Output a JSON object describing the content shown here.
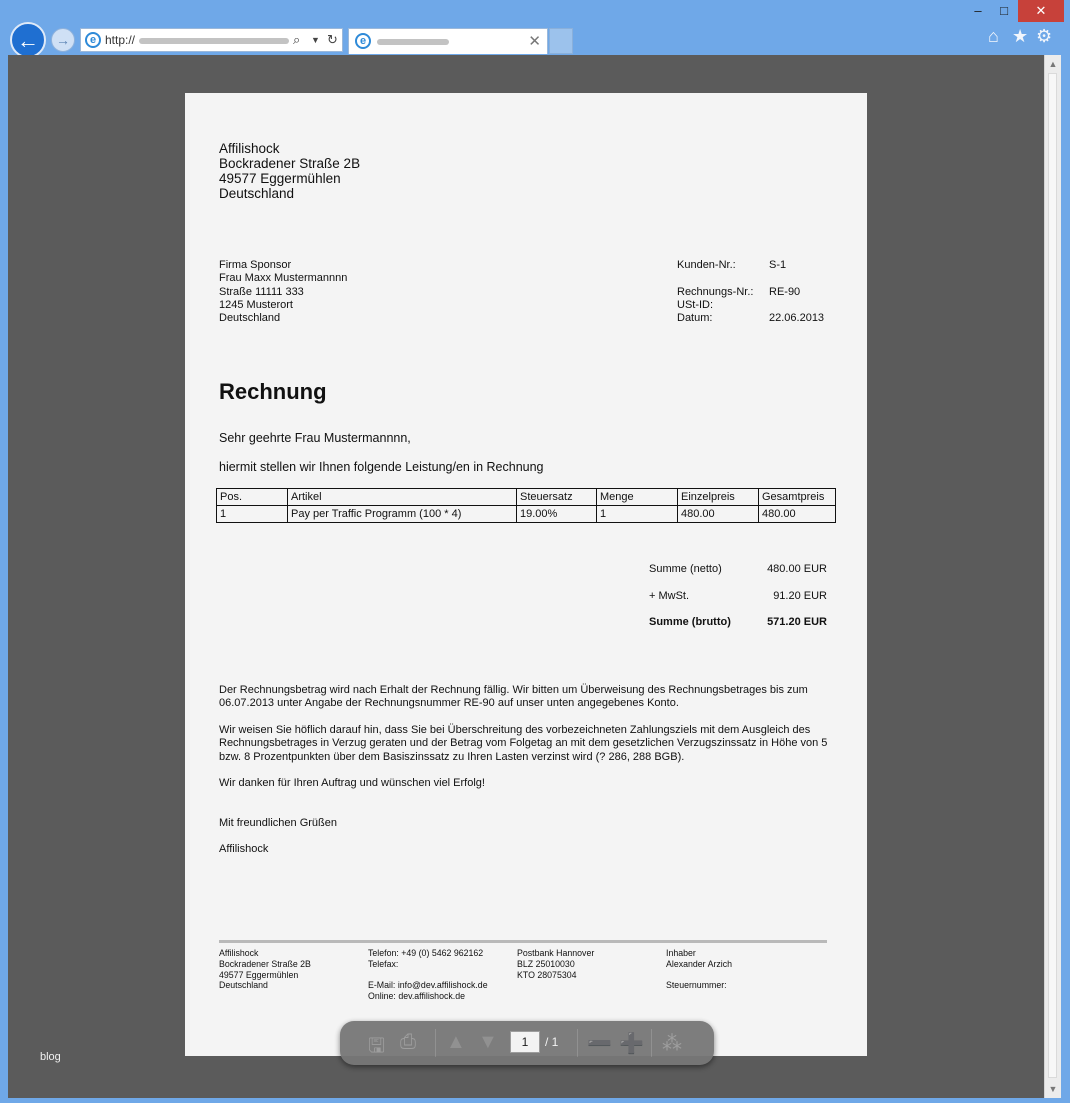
{
  "browser": {
    "window_controls": {
      "minimize": "–",
      "maximize": "□",
      "close": "✕"
    },
    "back_glyph": "🡐",
    "forward_glyph": "→",
    "address": {
      "prefix": "http://"
    },
    "tab_close": "✕",
    "icons": [
      "back-icon",
      "forward-icon",
      "ie-logo-icon",
      "search-icon",
      "dropdown-icon",
      "refresh-icon",
      "home-icon",
      "star-icon",
      "gear-icon"
    ]
  },
  "watermark": "blog",
  "invoice": {
    "sender": [
      "Affilishock",
      "Bockradener Straße 2B",
      "49577 Eggermühlen",
      "Deutschland"
    ],
    "recipient": [
      "Firma Sponsor",
      "Frau Maxx Mustermannnn",
      "Straße 11111 333",
      "1245 Musterort",
      "Deutschland"
    ],
    "meta": {
      "customer_label": "Kunden-Nr.:",
      "customer_value": "S-1",
      "invoice_label": "Rechnungs-Nr.:",
      "invoice_value": "RE-90",
      "vat_label": "USt-ID:",
      "vat_value": "",
      "date_label": "Datum:",
      "date_value": "22.06.2013"
    },
    "title": "Rechnung",
    "salutation": "Sehr geehrte Frau Mustermannnn,",
    "intro": "hiermit stellen wir Ihnen folgende Leistung/en in Rechnung",
    "table": {
      "headers": [
        "Pos.",
        "Artikel",
        "Steuersatz",
        "Menge",
        "Einzelpreis",
        "Gesamtpreis"
      ],
      "rows": [
        [
          "1",
          "Pay per Traffic Programm (100 * 4)",
          "19.00%",
          "1",
          "480.00",
          "480.00"
        ]
      ]
    },
    "totals": {
      "net_label": "Summe (netto)",
      "net_value": "480.00 EUR",
      "vat_label": "+ MwSt.",
      "vat_value": "91.20 EUR",
      "gross_label": "Summe (brutto)",
      "gross_value": "571.20 EUR"
    },
    "paragraphs": [
      "Der Rechnungsbetrag wird nach Erhalt der Rechnung fällig. Wir bitten um Überweisung des Rechnungsbetrages bis zum 06.07.2013 unter Angabe der Rechnungsnummer RE-90 auf unser unten angegebenes Konto.",
      "Wir weisen Sie höflich darauf hin, dass Sie bei Überschreitung des vorbezeichneten Zahlungsziels mit dem Ausgleich des Rechnungsbetrages in Verzug geraten und der Betrag vom Folgetag an mit dem gesetzlichen Verzugszinssatz in Höhe von 5 bzw. 8 Prozentpunkten über dem Basiszinssatz zu Ihren Lasten verzinst wird (? 286, 288 BGB).",
      "Wir danken für Ihren Auftrag und wünschen viel Erfolg!"
    ],
    "closing": "Mit freundlichen Grüßen",
    "signature": "Affilishock",
    "footer": {
      "col1": [
        "Affilishock",
        "Bockradener Straße 2B",
        "49577 Eggermühlen",
        "Deutschland"
      ],
      "col2": [
        "Telefon: +49 (0) 5462 962162",
        "Telefax:",
        "",
        "E-Mail: info@dev.affilishock.de",
        "Online: dev.affilishock.de"
      ],
      "col3": [
        "Postbank Hannover",
        "BLZ 25010030",
        "KTO 28075304"
      ],
      "col4": [
        "Inhaber",
        "Alexander Arzich",
        "",
        "Steuernummer:"
      ]
    }
  },
  "pdf_toolbar": {
    "current_page": "1",
    "page_total": "/ 1"
  }
}
